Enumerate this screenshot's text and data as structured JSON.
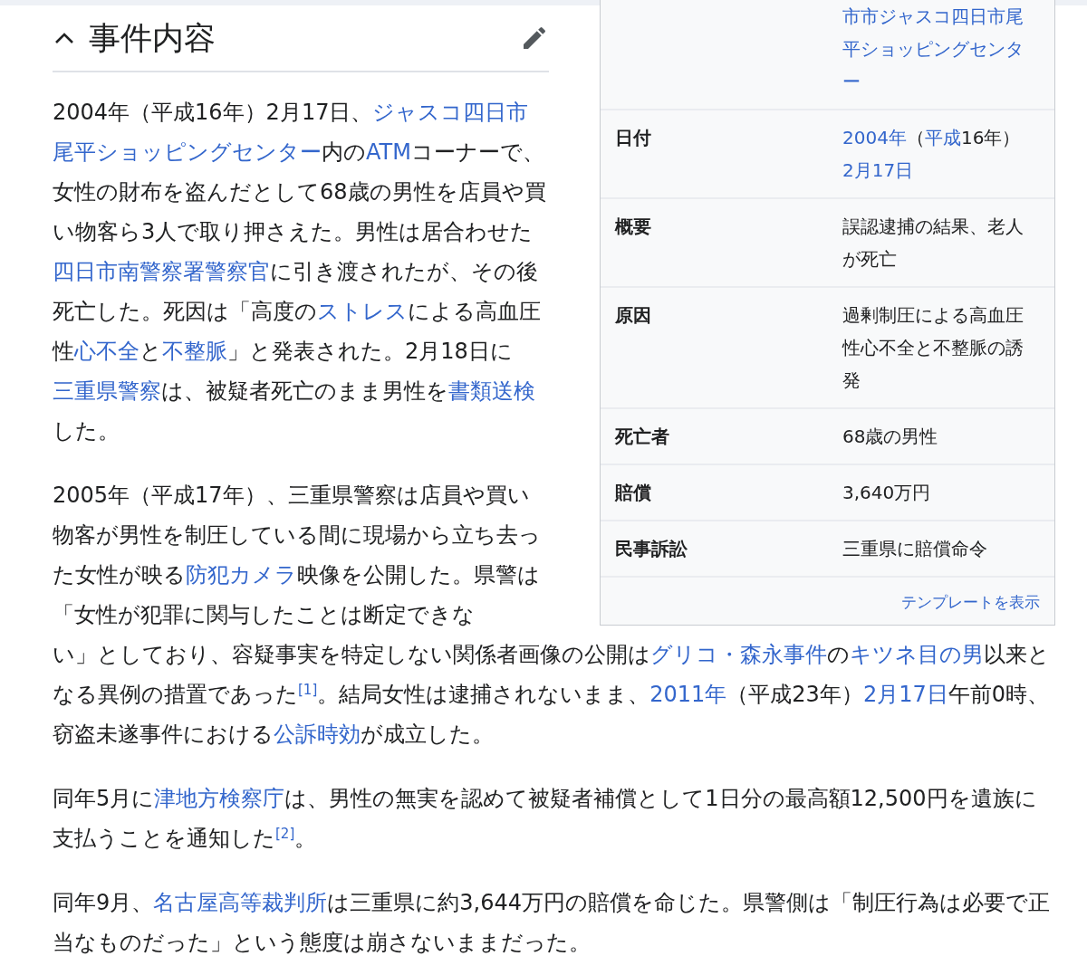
{
  "section": {
    "title": "事件内容",
    "expanded": true
  },
  "infobox": {
    "rows": [
      {
        "value": [
          {
            "kind": "link",
            "text": "市市ジャスコ四日市尾"
          },
          {
            "kind": "link",
            "text": "平ショッピングセンタ"
          },
          {
            "kind": "link",
            "text": "ー"
          }
        ]
      },
      {
        "label": "日付",
        "value": [
          {
            "kind": "link",
            "text": "2004年"
          },
          {
            "kind": "text",
            "text": "（"
          },
          {
            "kind": "link",
            "text": "平成"
          },
          {
            "kind": "text",
            "text": "16年）"
          },
          {
            "kind": "link",
            "text": "2月17日"
          }
        ]
      },
      {
        "label": "概要",
        "value": [
          {
            "kind": "text",
            "text": "誤認逮捕の結果、老人が死亡"
          }
        ]
      },
      {
        "label": "原因",
        "value": [
          {
            "kind": "text",
            "text": "過剰制圧による高血圧性心不全と不整脈の誘発"
          }
        ]
      },
      {
        "label": "死亡者",
        "value": [
          {
            "kind": "text",
            "text": "68歳の男性"
          }
        ]
      },
      {
        "label": "賠償",
        "value": [
          {
            "kind": "text",
            "text": "3,640万円"
          }
        ]
      },
      {
        "label": "民事訴訟",
        "value": [
          {
            "kind": "text",
            "text": "三重県に賠償命令"
          }
        ]
      }
    ],
    "footer_link": "テンプレートを表示"
  },
  "paragraphs_beside_infobox": [
    {
      "segments": [
        {
          "kind": "text",
          "text": "2004年（平成16年）2月17日、"
        },
        {
          "kind": "link",
          "text": "ジャスコ四日市"
        },
        {
          "kind": "link",
          "text": "尾平ショッピングセンター"
        },
        {
          "kind": "text",
          "text": "内の"
        },
        {
          "kind": "link",
          "text": "ATM"
        },
        {
          "kind": "text",
          "text": "コーナーで、女性の財布を盗んだとして68歳の男性を店員や買い物客ら3人で取り押さえた。男性は居合わせた"
        },
        {
          "kind": "link",
          "text": "四日市南警察署警察官"
        },
        {
          "kind": "text",
          "text": "に引き渡されたが、その後死亡した。死因は「高度の"
        },
        {
          "kind": "link",
          "text": "ストレス"
        },
        {
          "kind": "text",
          "text": "による高血圧性"
        },
        {
          "kind": "link",
          "text": "心不全"
        },
        {
          "kind": "text",
          "text": "と"
        },
        {
          "kind": "link",
          "text": "不整脈"
        },
        {
          "kind": "text",
          "text": "」と発表された。2月18日に"
        },
        {
          "kind": "link",
          "text": "三重県警察"
        },
        {
          "kind": "text",
          "text": "は、被疑者死亡のまま男性を"
        },
        {
          "kind": "link",
          "text": "書類送検"
        },
        {
          "kind": "text",
          "text": "した。"
        }
      ]
    },
    {
      "segments": [
        {
          "kind": "text",
          "text": "2005年（平成17年）、三重県警察は店員や買い物客が男性を制圧している間に現場から立ち去った女性が映る"
        },
        {
          "kind": "link",
          "text": "防犯カメラ"
        },
        {
          "kind": "text",
          "text": "映像を公開した。県警は「女性が犯罪に関与したことは断定できな"
        }
      ]
    }
  ],
  "paragraphs_below_infobox": [
    {
      "segments": [
        {
          "kind": "text",
          "text": "い」としており、容疑事実を特定しない関係者画像の公開は"
        },
        {
          "kind": "link",
          "text": "グリコ・森永事件"
        },
        {
          "kind": "text",
          "text": "の"
        },
        {
          "kind": "link",
          "text": "キツネ目の男"
        },
        {
          "kind": "text",
          "text": "以来となる異例の措置であった"
        },
        {
          "kind": "ref",
          "text": "[1]"
        },
        {
          "kind": "text",
          "text": "。結局女性は逮捕されないまま、"
        },
        {
          "kind": "link",
          "text": "2011年"
        },
        {
          "kind": "text",
          "text": "（平成23年）"
        },
        {
          "kind": "link",
          "text": "2月17日"
        },
        {
          "kind": "text",
          "text": "午前0時、窃盗未遂事件における"
        },
        {
          "kind": "link",
          "text": "公訴時効"
        },
        {
          "kind": "text",
          "text": "が成立した。"
        }
      ]
    },
    {
      "segments": [
        {
          "kind": "text",
          "text": "同年5月に"
        },
        {
          "kind": "link",
          "text": "津地方検察庁"
        },
        {
          "kind": "text",
          "text": "は、男性の無実を認めて被疑者補償として1日分の最高額12,500円を遺族に支払うことを通知した"
        },
        {
          "kind": "ref",
          "text": "[2]"
        },
        {
          "kind": "text",
          "text": "。"
        }
      ]
    },
    {
      "segments": [
        {
          "kind": "text",
          "text": "同年9月、"
        },
        {
          "kind": "link",
          "text": "名古屋高等裁判所"
        },
        {
          "kind": "text",
          "text": "は三重県に約3,644万円の賠償を命じた。県警側は「制圧行為は必要で正当なものだった」という態度は崩さないままだった。"
        }
      ]
    }
  ]
}
